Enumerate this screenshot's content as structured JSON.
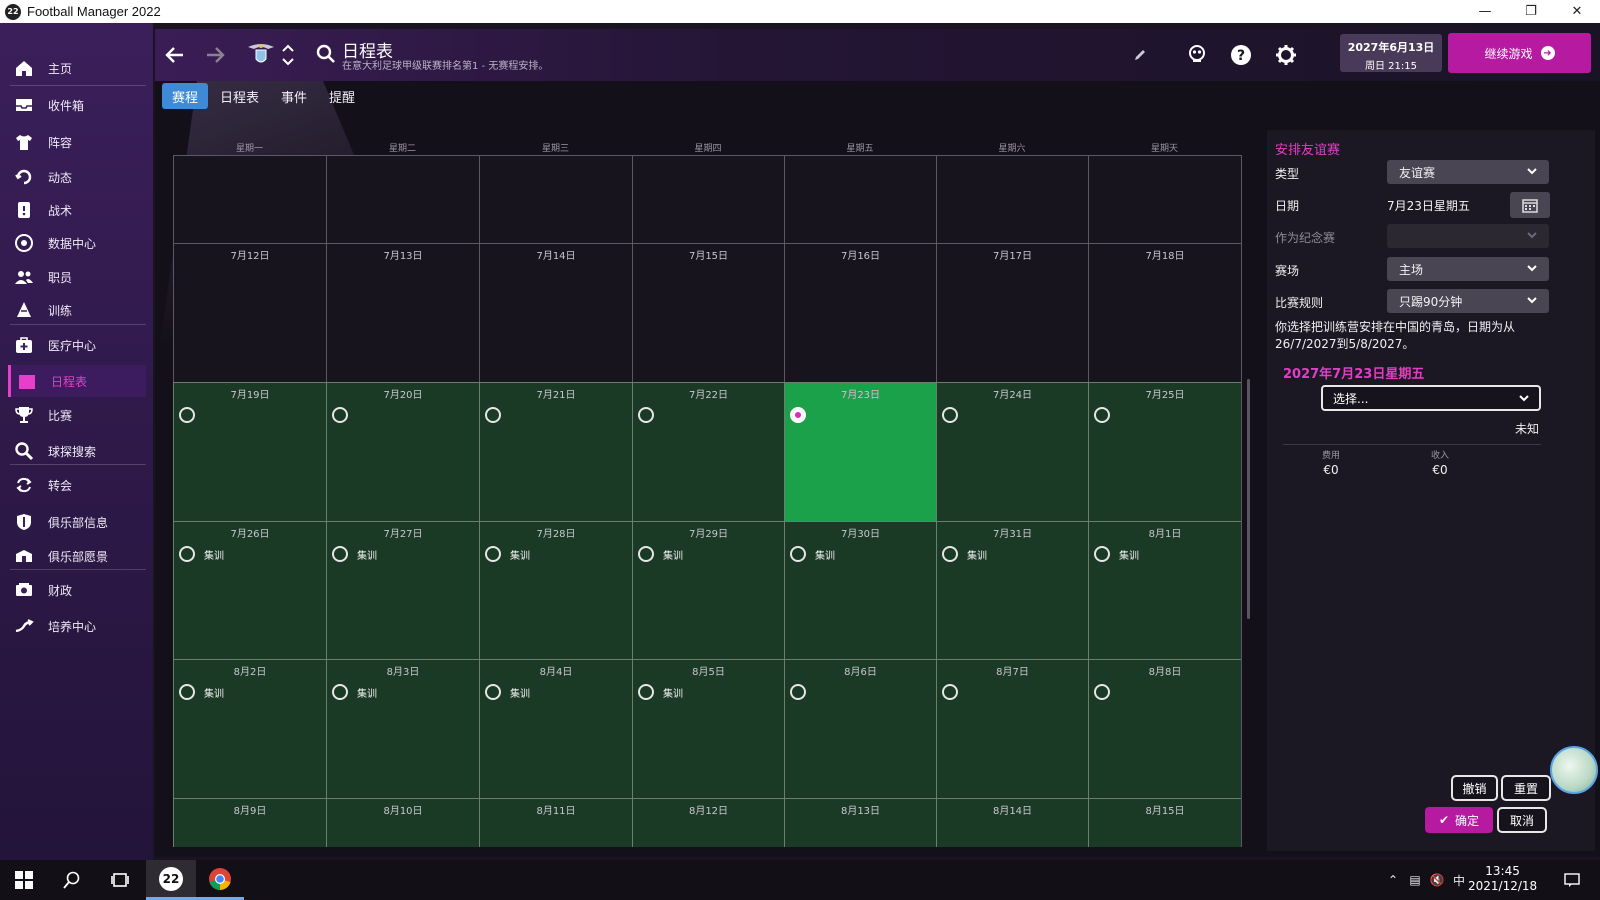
{
  "window": {
    "title": "Football Manager 2022",
    "badge": "22"
  },
  "sidebar": {
    "items": [
      {
        "label": "主页",
        "icon": "home-icon"
      },
      {
        "label": "收件箱",
        "icon": "inbox-icon"
      },
      {
        "label": "阵容",
        "icon": "shirt-icon"
      },
      {
        "label": "动态",
        "icon": "dynamics-icon"
      },
      {
        "label": "战术",
        "icon": "tactics-icon"
      },
      {
        "label": "数据中心",
        "icon": "data-hub-icon"
      },
      {
        "label": "职员",
        "icon": "staff-icon"
      },
      {
        "label": "训练",
        "icon": "training-icon"
      },
      {
        "label": "医疗中心",
        "icon": "medical-icon"
      },
      {
        "label": "日程表",
        "icon": "calendar-icon"
      },
      {
        "label": "比赛",
        "icon": "trophy-icon"
      },
      {
        "label": "球探搜索",
        "icon": "scouting-icon"
      },
      {
        "label": "转会",
        "icon": "transfers-icon"
      },
      {
        "label": "俱乐部信息",
        "icon": "club-info-icon"
      },
      {
        "label": "俱乐部愿景",
        "icon": "club-vision-icon"
      },
      {
        "label": "财政",
        "icon": "finances-icon"
      },
      {
        "label": "培养中心",
        "icon": "development-icon"
      }
    ],
    "active_index": 9
  },
  "header": {
    "title": "日程表",
    "subtitle": "在意大利足球甲级联赛排名第1 - 无赛程安排。",
    "date_line1": "2027年6月13日",
    "date_line2": "周日 21:15",
    "continue_label": "继续游戏"
  },
  "tabs": [
    {
      "label": "赛程",
      "active": true
    },
    {
      "label": "日程表",
      "active": false
    },
    {
      "label": "事件",
      "active": false
    },
    {
      "label": "提醒",
      "active": false
    }
  ],
  "calendar": {
    "weekdays": [
      "星期一",
      "星期二",
      "星期三",
      "星期四",
      "星期五",
      "星期六",
      "星期天"
    ],
    "rows": [
      {
        "dates": [
          "",
          "",
          "",
          "",
          "",
          "",
          ""
        ],
        "style": "dark",
        "radios": false
      },
      {
        "dates": [
          "7月12日",
          "7月13日",
          "7月14日",
          "7月15日",
          "7月16日",
          "7月17日",
          "7月18日"
        ],
        "style": "dark",
        "radios": false
      },
      {
        "dates": [
          "7月19日",
          "7月20日",
          "7月21日",
          "7月22日",
          "7月23日",
          "7月24日",
          "7月25日"
        ],
        "style": "green",
        "radios": true,
        "events": [
          "",
          "",
          "",
          "",
          "",
          "",
          ""
        ]
      },
      {
        "dates": [
          "7月26日",
          "7月27日",
          "7月28日",
          "7月29日",
          "7月30日",
          "7月31日",
          "8月1日"
        ],
        "style": "green",
        "radios": true,
        "events": [
          "集训",
          "集训",
          "集训",
          "集训",
          "集训",
          "集训",
          "集训"
        ]
      },
      {
        "dates": [
          "8月2日",
          "8月3日",
          "8月4日",
          "8月5日",
          "8月6日",
          "8月7日",
          "8月8日"
        ],
        "style": "green",
        "radios": true,
        "events": [
          "集训",
          "集训",
          "集训",
          "集训",
          "",
          "",
          ""
        ]
      },
      {
        "dates": [
          "8月9日",
          "8月10日",
          "8月11日",
          "8月12日",
          "8月13日",
          "8月14日",
          "8月15日"
        ],
        "style": "green",
        "radios": false
      }
    ],
    "selected": {
      "row": 2,
      "col": 4
    }
  },
  "panel": {
    "title": "安排友谊赛",
    "type_label": "类型",
    "type_value": "友谊赛",
    "date_label": "日期",
    "date_value": "7月23日星期五",
    "memorial_label": "作为纪念赛",
    "memorial_value": "",
    "venue_label": "赛场",
    "venue_value": "主场",
    "rules_label": "比赛规则",
    "rules_value": "只踢90分钟",
    "note": "你选择把训练营安排在中国的青岛，日期为从26/7/2027到5/8/2027。",
    "selected_date": "2027年7月23日星期五",
    "opponent_placeholder": "选择...",
    "opponent_status": "未知",
    "cost_label": "费用",
    "cost_value": "€0",
    "income_label": "收入",
    "income_value": "€0",
    "undo_label": "撤销",
    "reset_label": "重置",
    "confirm_label": "确定",
    "cancel_label": "取消"
  },
  "taskbar": {
    "time": "13:45",
    "date": "2021/12/18",
    "ime": "中",
    "fm_badge": "22"
  },
  "colors": {
    "accent": "#b51aa0",
    "highlight": "#e43dc6",
    "selected_day": "#1aa14a",
    "camp_day": "#1b3a26",
    "tab_active": "#3e8ad6"
  }
}
